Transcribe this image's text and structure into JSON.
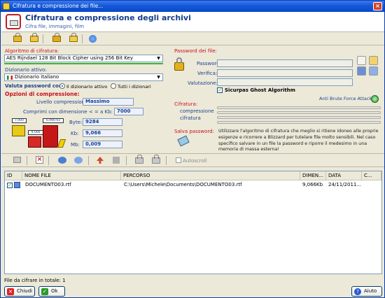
{
  "window": {
    "title": "Cifratura e compressione dei file..."
  },
  "header": {
    "title": "Cifratura e compressione degli archivi",
    "subtitle": "Cifra file, immagini, film"
  },
  "toolbar_top": {
    "icons": [
      "lock-icon",
      "unlock-icon",
      "lock-folder-icon",
      "unlock-folder-icon",
      "settings-icon"
    ]
  },
  "cipher": {
    "algo_label": "Algoritmo di cifratura:",
    "algo_value": "AES Rijndael 128 Bit Block Cipher using 256 Bit Key",
    "dict_label": "Dizionario attivo:",
    "dict_value": "Dizionario italiano",
    "validate_label": "Valuta password con:",
    "radio_active": "Il dizionario attivo",
    "radio_all": "Tutti i dizionari"
  },
  "compression": {
    "title": "Opzioni di compressione:",
    "level_label": "Livello compressione:",
    "level_value": "Massimo",
    "min_size_label": "Comprimi con dimensione < = a Kb:",
    "min_size_value": "7000",
    "byte_label": "Byte:",
    "byte_value": "9284",
    "kb_label": "Kb:",
    "kb_value": "9,066",
    "mb_label": "Mb:",
    "mb_value": "0,009",
    "box_small": "7,000",
    "box_mid": "9,066",
    "box_big": "6,990.93"
  },
  "password": {
    "title": "Password dei file:",
    "password_label": "Password:",
    "verify_label": "Verifica:",
    "rating_label": "Valutazione:",
    "ghost_label": "Sicurpas Ghost Algorithm",
    "anti_brute": "Anti Brute Force Attack",
    "cipher_label": "Cifratura:",
    "comp_label": "compressione",
    "cipher_label2": "cifratura",
    "save_label": "Salva password:",
    "info": "Utilizzare l'algoritmo di cifratura che meglio si ritiene idoneo alle proprie esigenze e ricorrere a Blizzard per tutelare file molto sensibili. Nel caso specifico salvare in un file la password e riporre il medesimo in una memoria di massa esterna!"
  },
  "toolbar_files": {
    "autoscroll": "Autoscroll"
  },
  "table": {
    "columns": [
      "ID",
      "NOME FILE",
      "PERCORSO",
      "DIMEN...",
      "DATA",
      "C..."
    ],
    "rows": [
      {
        "name": "DOCUMENTO03.rtf",
        "path": "C:\\Users\\Michele\\Documents\\DOCUMENTO03.rtf",
        "size": "9,066Kb",
        "date": "24/11/2011..."
      }
    ]
  },
  "status": {
    "text": "File da cifrare in totale: 1"
  },
  "buttons": {
    "close": "Chiudi",
    "ok": "Ok",
    "help": "Aiuto"
  }
}
